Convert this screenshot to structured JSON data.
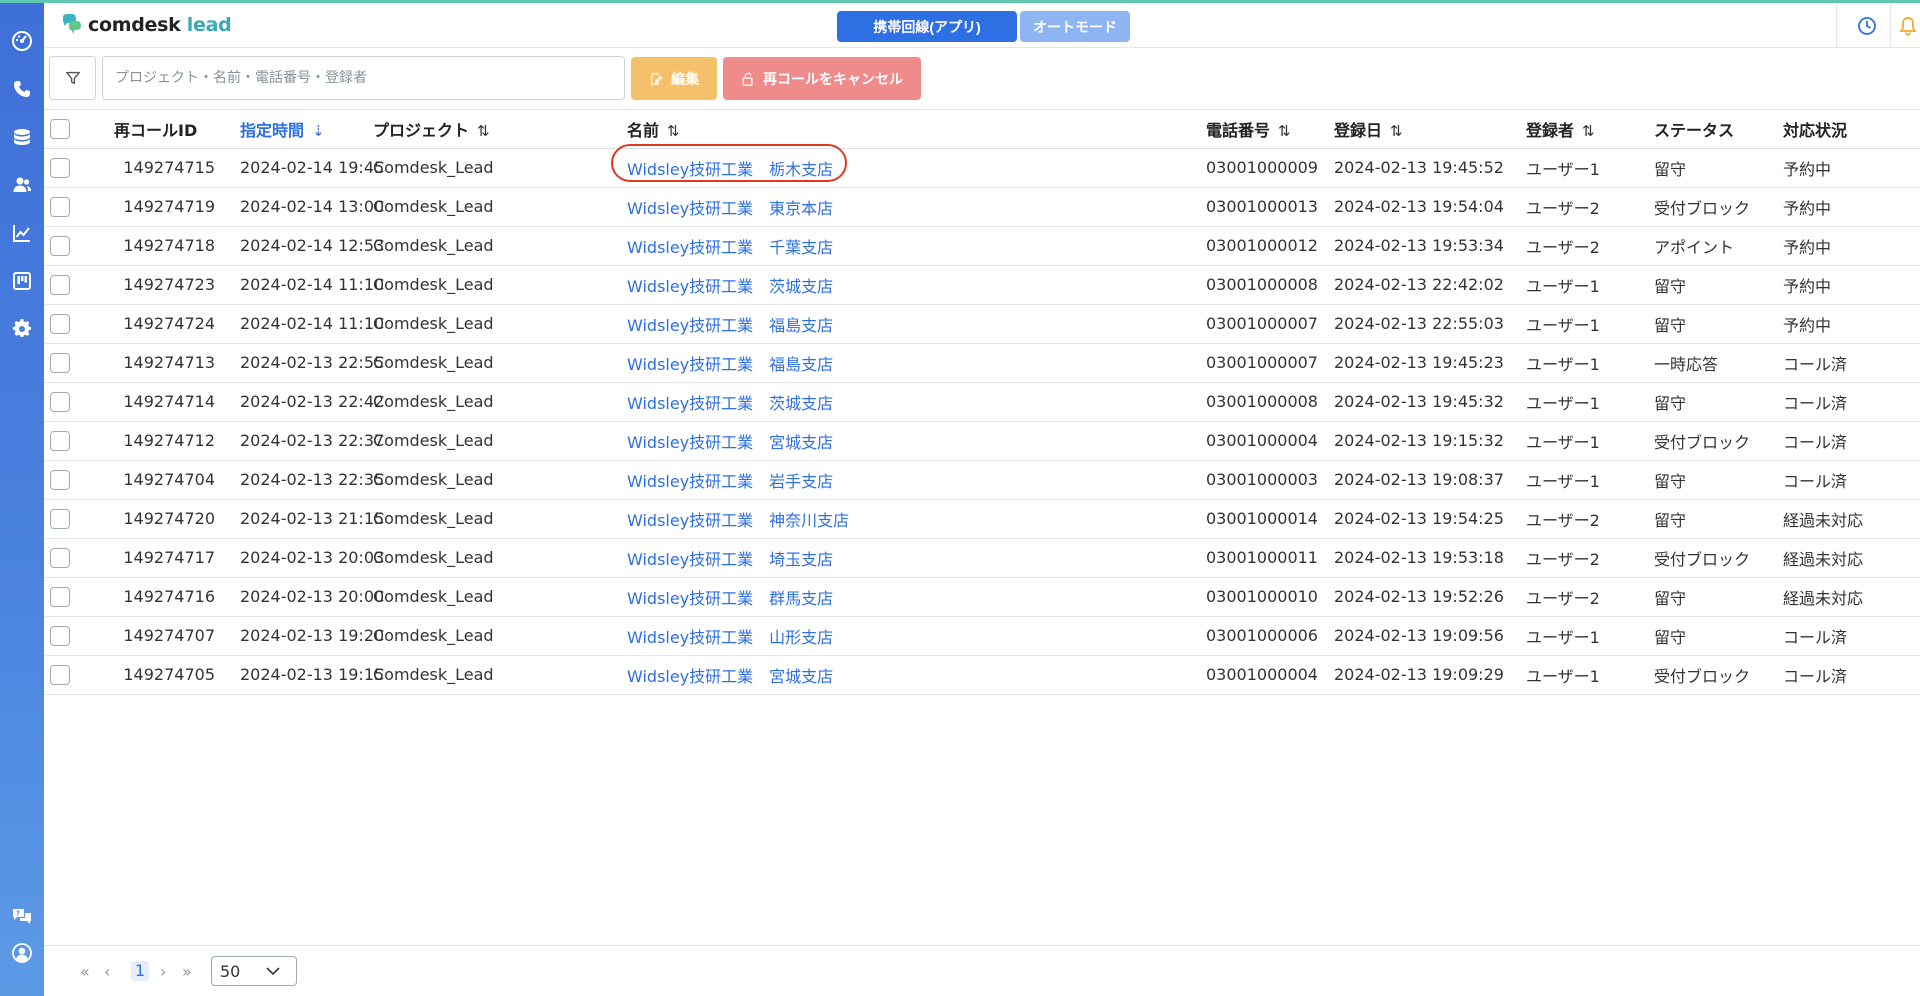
{
  "app": {
    "brand": "comdesk",
    "brand_suffix": "lead",
    "accent": "#2f6fe4",
    "sidebar_color": "#4a82df"
  },
  "header": {
    "mode_primary": "携帯回線(アプリ)",
    "mode_secondary": "オートモード"
  },
  "sidebar": {
    "items": [
      {
        "icon": "dashboard-icon"
      },
      {
        "icon": "phone-icon"
      },
      {
        "icon": "database-icon"
      },
      {
        "icon": "users-icon"
      },
      {
        "icon": "chart-icon"
      },
      {
        "icon": "board-icon"
      },
      {
        "icon": "settings-icon"
      }
    ],
    "bottom": [
      {
        "icon": "help-chat-icon"
      },
      {
        "icon": "account-icon"
      }
    ]
  },
  "toolbar": {
    "search_placeholder": "プロジェクト・名前・電話番号・登録者",
    "edit_label": "編集",
    "cancel_label": "再コールをキャンセル"
  },
  "table": {
    "columns": [
      {
        "key": "id",
        "label": "再コールID"
      },
      {
        "key": "time",
        "label": "指定時間",
        "sorted": true
      },
      {
        "key": "project",
        "label": "プロジェクト"
      },
      {
        "key": "name",
        "label": "名前"
      },
      {
        "key": "phone",
        "label": "電話番号"
      },
      {
        "key": "registered",
        "label": "登録日"
      },
      {
        "key": "registrant",
        "label": "登録者"
      },
      {
        "key": "status",
        "label": "ステータス"
      },
      {
        "key": "state",
        "label": "対応状況"
      }
    ],
    "rows": [
      {
        "id": "149274715",
        "time": "2024-02-14 19:45",
        "project": "Comdesk_Lead",
        "company": "Widsley技研工業",
        "branch": "栃木支店",
        "phone": "03001000009",
        "registered": "2024-02-13 19:45:52",
        "registrant": "ユーザー1",
        "status": "留守",
        "state": "予約中",
        "highlighted": true
      },
      {
        "id": "149274719",
        "time": "2024-02-14 13:00",
        "project": "Comdesk_Lead",
        "company": "Widsley技研工業",
        "branch": "東京本店",
        "phone": "03001000013",
        "registered": "2024-02-13 19:54:04",
        "registrant": "ユーザー2",
        "status": "受付ブロック",
        "state": "予約中"
      },
      {
        "id": "149274718",
        "time": "2024-02-14 12:53",
        "project": "Comdesk_Lead",
        "company": "Widsley技研工業",
        "branch": "千葉支店",
        "phone": "03001000012",
        "registered": "2024-02-13 19:53:34",
        "registrant": "ユーザー2",
        "status": "アポイント",
        "state": "予約中"
      },
      {
        "id": "149274723",
        "time": "2024-02-14 11:10",
        "project": "Comdesk_Lead",
        "company": "Widsley技研工業",
        "branch": "茨城支店",
        "phone": "03001000008",
        "registered": "2024-02-13 22:42:02",
        "registrant": "ユーザー1",
        "status": "留守",
        "state": "予約中"
      },
      {
        "id": "149274724",
        "time": "2024-02-14 11:10",
        "project": "Comdesk_Lead",
        "company": "Widsley技研工業",
        "branch": "福島支店",
        "phone": "03001000007",
        "registered": "2024-02-13 22:55:03",
        "registrant": "ユーザー1",
        "status": "留守",
        "state": "予約中"
      },
      {
        "id": "149274713",
        "time": "2024-02-13 22:55",
        "project": "Comdesk_Lead",
        "company": "Widsley技研工業",
        "branch": "福島支店",
        "phone": "03001000007",
        "registered": "2024-02-13 19:45:23",
        "registrant": "ユーザー1",
        "status": "一時応答",
        "state": "コール済"
      },
      {
        "id": "149274714",
        "time": "2024-02-13 22:42",
        "project": "Comdesk_Lead",
        "company": "Widsley技研工業",
        "branch": "茨城支店",
        "phone": "03001000008",
        "registered": "2024-02-13 19:45:32",
        "registrant": "ユーザー1",
        "status": "留守",
        "state": "コール済"
      },
      {
        "id": "149274712",
        "time": "2024-02-13 22:37",
        "project": "Comdesk_Lead",
        "company": "Widsley技研工業",
        "branch": "宮城支店",
        "phone": "03001000004",
        "registered": "2024-02-13 19:15:32",
        "registrant": "ユーザー1",
        "status": "受付ブロック",
        "state": "コール済"
      },
      {
        "id": "149274704",
        "time": "2024-02-13 22:35",
        "project": "Comdesk_Lead",
        "company": "Widsley技研工業",
        "branch": "岩手支店",
        "phone": "03001000003",
        "registered": "2024-02-13 19:08:37",
        "registrant": "ユーザー1",
        "status": "留守",
        "state": "コール済"
      },
      {
        "id": "149274720",
        "time": "2024-02-13 21:15",
        "project": "Comdesk_Lead",
        "company": "Widsley技研工業",
        "branch": "神奈川支店",
        "phone": "03001000014",
        "registered": "2024-02-13 19:54:25",
        "registrant": "ユーザー2",
        "status": "留守",
        "state": "経過未対応"
      },
      {
        "id": "149274717",
        "time": "2024-02-13 20:03",
        "project": "Comdesk_Lead",
        "company": "Widsley技研工業",
        "branch": "埼玉支店",
        "phone": "03001000011",
        "registered": "2024-02-13 19:53:18",
        "registrant": "ユーザー2",
        "status": "受付ブロック",
        "state": "経過未対応"
      },
      {
        "id": "149274716",
        "time": "2024-02-13 20:00",
        "project": "Comdesk_Lead",
        "company": "Widsley技研工業",
        "branch": "群馬支店",
        "phone": "03001000010",
        "registered": "2024-02-13 19:52:26",
        "registrant": "ユーザー2",
        "status": "留守",
        "state": "経過未対応"
      },
      {
        "id": "149274707",
        "time": "2024-02-13 19:20",
        "project": "Comdesk_Lead",
        "company": "Widsley技研工業",
        "branch": "山形支店",
        "phone": "03001000006",
        "registered": "2024-02-13 19:09:56",
        "registrant": "ユーザー1",
        "status": "留守",
        "state": "コール済"
      },
      {
        "id": "149274705",
        "time": "2024-02-13 19:15",
        "project": "Comdesk_Lead",
        "company": "Widsley技研工業",
        "branch": "宮城支店",
        "phone": "03001000004",
        "registered": "2024-02-13 19:09:29",
        "registrant": "ユーザー1",
        "status": "受付ブロック",
        "state": "コール済"
      }
    ]
  },
  "pagination": {
    "first": "«",
    "prev": "‹",
    "current_page": "1",
    "next": "›",
    "last": "»",
    "page_size": "50"
  }
}
